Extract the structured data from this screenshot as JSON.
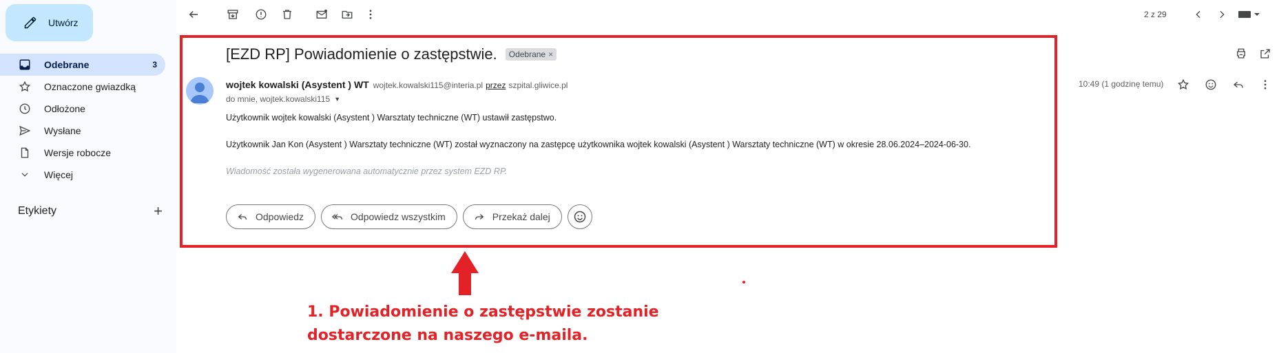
{
  "compose": {
    "label": "Utwórz",
    "icon": "pencil-icon"
  },
  "nav": [
    {
      "label": "Odebrane",
      "count": "3",
      "icon": "inbox-icon",
      "active": true
    },
    {
      "label": "Oznaczone gwiazdką",
      "icon": "star-icon"
    },
    {
      "label": "Odłożone",
      "icon": "clock-icon"
    },
    {
      "label": "Wysłane",
      "icon": "send-icon"
    },
    {
      "label": "Wersje robocze",
      "icon": "draft-icon"
    },
    {
      "label": "Więcej",
      "icon": "chevron-down-icon"
    }
  ],
  "labels": {
    "title": "Etykiety",
    "add": "+"
  },
  "toolbar": {
    "pager": "2 z 29"
  },
  "message": {
    "subject": "[EZD RP] Powiadomienie o zastępstwie.",
    "tag": "Odebrane",
    "tag_close": "×",
    "sender_name": "wojtek kowalski (Asystent ) WT",
    "sender_email": "wojtek.kowalski115@interia.pl",
    "via_label": "przez",
    "via_domain": "szpital.gliwice.pl",
    "to": "do mnie, wojtek.kowalski115",
    "time": "10:49 (1 godzinę temu)",
    "body_line1": "Użytkownik wojtek kowalski (Asystent ) Warsztaty techniczne (WT) ustawił zastępstwo.",
    "body_line2": "Użytkownik Jan Kon (Asystent ) Warsztaty techniczne (WT) został wyznaczony na zastępcę użytkownika wojtek kowalski (Asystent ) Warsztaty techniczne (WT) w okresie 28.06.2024–2024-06-30.",
    "auto_note": "Wiadomość została wygenerowana automatycznie przez system EZD RP."
  },
  "actions": {
    "reply": "Odpowiedz",
    "reply_all": "Odpowiedz wszystkim",
    "forward": "Przekaż dalej"
  },
  "annotation": {
    "line1": "1. Powiadomienie o zastępstwie zostanie",
    "line2": "dostarczone na naszego e-maila."
  },
  "colors": {
    "highlight": "#e32227",
    "compose_bg": "#c2e7ff",
    "active_nav": "#d3e3fd"
  }
}
